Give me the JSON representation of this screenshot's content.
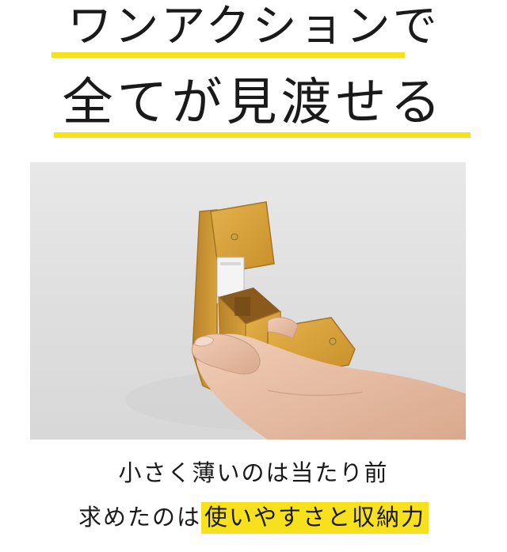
{
  "headline": {
    "line1": "ワンアクションで",
    "line2": "全てが見渡せる"
  },
  "photo": {
    "subject": "wallet-in-hand-photo"
  },
  "caption": {
    "line1": "小さく薄いのは当たり前",
    "line2_plain": "求めたのは",
    "line2_highlight": "使いやすさと収納力"
  },
  "colors": {
    "accent_yellow": "#f7e01c",
    "text": "#1a1a1a",
    "leather": "#d9a53a",
    "background": "#ffffff"
  }
}
